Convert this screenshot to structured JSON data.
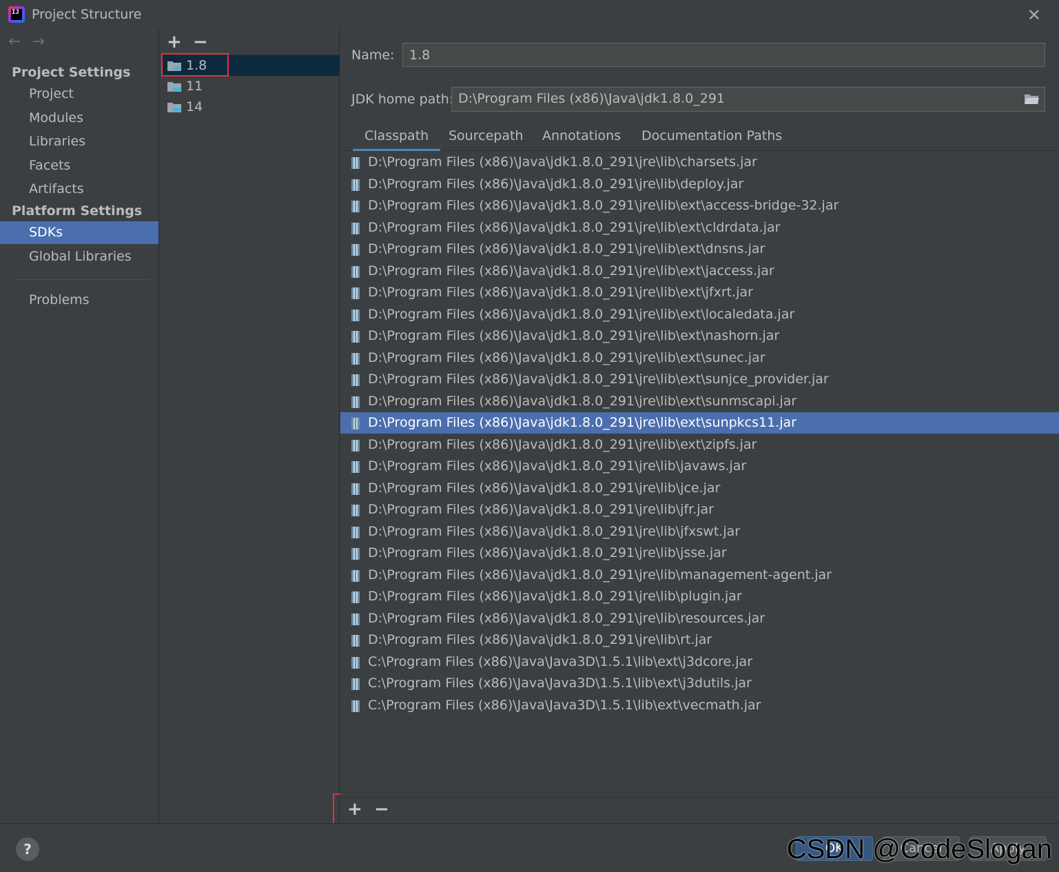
{
  "window": {
    "title": "Project Structure",
    "close": "✕"
  },
  "sidebar": {
    "back": "←",
    "forward": "→",
    "project_settings": "Project Settings",
    "project_items": [
      "Project",
      "Modules",
      "Libraries",
      "Facets",
      "Artifacts"
    ],
    "platform_settings": "Platform Settings",
    "platform_items": [
      "SDKs",
      "Global Libraries"
    ],
    "problems": "Problems",
    "selected": "SDKs"
  },
  "sdk_list": {
    "add": "+",
    "remove": "−",
    "items": [
      "1.8",
      "11",
      "14"
    ],
    "selected": "1.8"
  },
  "details": {
    "name_label": "Name:",
    "name_value": "1.8",
    "jdk_home_label": "JDK home path:",
    "jdk_home_value": "D:\\Program Files (x86)\\Java\\jdk1.8.0_291",
    "tabs": [
      "Classpath",
      "Sourcepath",
      "Annotations",
      "Documentation Paths"
    ],
    "active_tab": "Classpath",
    "classpath": [
      "D:\\Program Files (x86)\\Java\\jdk1.8.0_291\\jre\\lib\\charsets.jar",
      "D:\\Program Files (x86)\\Java\\jdk1.8.0_291\\jre\\lib\\deploy.jar",
      "D:\\Program Files (x86)\\Java\\jdk1.8.0_291\\jre\\lib\\ext\\access-bridge-32.jar",
      "D:\\Program Files (x86)\\Java\\jdk1.8.0_291\\jre\\lib\\ext\\cldrdata.jar",
      "D:\\Program Files (x86)\\Java\\jdk1.8.0_291\\jre\\lib\\ext\\dnsns.jar",
      "D:\\Program Files (x86)\\Java\\jdk1.8.0_291\\jre\\lib\\ext\\jaccess.jar",
      "D:\\Program Files (x86)\\Java\\jdk1.8.0_291\\jre\\lib\\ext\\jfxrt.jar",
      "D:\\Program Files (x86)\\Java\\jdk1.8.0_291\\jre\\lib\\ext\\localedata.jar",
      "D:\\Program Files (x86)\\Java\\jdk1.8.0_291\\jre\\lib\\ext\\nashorn.jar",
      "D:\\Program Files (x86)\\Java\\jdk1.8.0_291\\jre\\lib\\ext\\sunec.jar",
      "D:\\Program Files (x86)\\Java\\jdk1.8.0_291\\jre\\lib\\ext\\sunjce_provider.jar",
      "D:\\Program Files (x86)\\Java\\jdk1.8.0_291\\jre\\lib\\ext\\sunmscapi.jar",
      "D:\\Program Files (x86)\\Java\\jdk1.8.0_291\\jre\\lib\\ext\\sunpkcs11.jar",
      "D:\\Program Files (x86)\\Java\\jdk1.8.0_291\\jre\\lib\\ext\\zipfs.jar",
      "D:\\Program Files (x86)\\Java\\jdk1.8.0_291\\jre\\lib\\javaws.jar",
      "D:\\Program Files (x86)\\Java\\jdk1.8.0_291\\jre\\lib\\jce.jar",
      "D:\\Program Files (x86)\\Java\\jdk1.8.0_291\\jre\\lib\\jfr.jar",
      "D:\\Program Files (x86)\\Java\\jdk1.8.0_291\\jre\\lib\\jfxswt.jar",
      "D:\\Program Files (x86)\\Java\\jdk1.8.0_291\\jre\\lib\\jsse.jar",
      "D:\\Program Files (x86)\\Java\\jdk1.8.0_291\\jre\\lib\\management-agent.jar",
      "D:\\Program Files (x86)\\Java\\jdk1.8.0_291\\jre\\lib\\plugin.jar",
      "D:\\Program Files (x86)\\Java\\jdk1.8.0_291\\jre\\lib\\resources.jar",
      "D:\\Program Files (x86)\\Java\\jdk1.8.0_291\\jre\\lib\\rt.jar",
      "C:\\Program Files (x86)\\Java\\Java3D\\1.5.1\\lib\\ext\\j3dcore.jar",
      "C:\\Program Files (x86)\\Java\\Java3D\\1.5.1\\lib\\ext\\j3dutils.jar",
      "C:\\Program Files (x86)\\Java\\Java3D\\1.5.1\\lib\\ext\\vecmath.jar"
    ],
    "selected_classpath_index": 12,
    "add": "+",
    "remove": "−"
  },
  "footer": {
    "help": "?",
    "ok": "OK",
    "cancel": "Cancel",
    "apply": "Apply"
  },
  "watermark": "CSDN @CodeSlogan",
  "colors": {
    "background": "#3c3f41",
    "selection": "#4b6eaf",
    "highlight_box": "#e8313b",
    "tab_underline": "#4a88c7"
  }
}
